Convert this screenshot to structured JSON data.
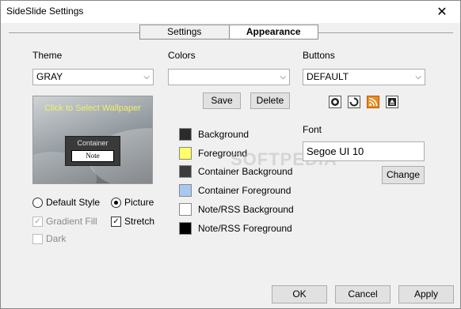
{
  "window": {
    "title": "SideSlide Settings",
    "close_glyph": "✕"
  },
  "tabs": [
    {
      "label": "Settings",
      "active": false
    },
    {
      "label": "Appearance",
      "active": true
    }
  ],
  "theme": {
    "label": "Theme",
    "selected": "GRAY",
    "preview": {
      "wallpaper_text": "Click to Select Wallpaper",
      "container_label": "Container",
      "note_label": "Note"
    },
    "radio_default": {
      "label": "Default Style",
      "checked": false
    },
    "radio_picture": {
      "label": "Picture",
      "checked": true
    },
    "gradient_fill": {
      "label": "Gradient Fill",
      "checked": true,
      "enabled": false
    },
    "stretch": {
      "label": "Stretch",
      "checked": true,
      "enabled": true
    },
    "dark": {
      "label": "Dark",
      "checked": false,
      "enabled": false
    }
  },
  "colors": {
    "label": "Colors",
    "selected": "",
    "save_label": "Save",
    "delete_label": "Delete",
    "items": [
      {
        "label": "Background",
        "color": "#2b2b2b"
      },
      {
        "label": "Foreground",
        "color": "#ffff66"
      },
      {
        "label": "Container Background",
        "color": "#3c3c3c"
      },
      {
        "label": "Container Foreground",
        "color": "#a8c8f0"
      },
      {
        "label": "Note/RSS Background",
        "color": "#ffffff"
      },
      {
        "label": "Note/RSS Foreground",
        "color": "#000000"
      }
    ]
  },
  "buttons": {
    "label": "Buttons",
    "selected": "DEFAULT",
    "icons": [
      {
        "name": "record-icon",
        "bg": "#ffffff"
      },
      {
        "name": "refresh-icon",
        "bg": "#ffffff"
      },
      {
        "name": "rss-icon",
        "bg": "#f08a1c"
      },
      {
        "name": "eject-icon",
        "bg": "#ffffff"
      }
    ]
  },
  "font": {
    "label": "Font",
    "value": "Segoe UI 10",
    "change_label": "Change"
  },
  "watermark": "SOFTPEDIA",
  "footer": {
    "ok_label": "OK",
    "cancel_label": "Cancel",
    "apply_label": "Apply"
  }
}
